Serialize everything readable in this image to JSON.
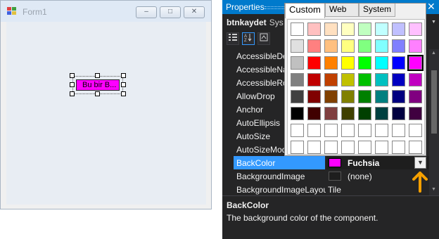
{
  "form": {
    "title": "Form1",
    "min_glyph": "–",
    "max_glyph": "□",
    "close_glyph": "✕",
    "button_text": "Bu bir B...",
    "button_color": "#ff00ff"
  },
  "properties": {
    "title": "Properties",
    "close_glyph": "✕",
    "dropdown_glyph": "▼",
    "object_name": "btnkaydet",
    "object_type": "Sys",
    "rows": [
      {
        "name": "AccessibleDe",
        "value": ""
      },
      {
        "name": "AccessibleNa",
        "value": ""
      },
      {
        "name": "AccessibleRo",
        "value": ""
      },
      {
        "name": "AllowDrop",
        "value": ""
      },
      {
        "name": "Anchor",
        "value": ""
      },
      {
        "name": "AutoEllipsis",
        "value": ""
      },
      {
        "name": "AutoSize",
        "value": ""
      },
      {
        "name": "AutoSizeMod",
        "value": ""
      },
      {
        "name": "BackColor",
        "value": "Fuchsia",
        "swatch": "#ff00ff",
        "selected": true
      },
      {
        "name": "BackgroundImage",
        "value": "(none)"
      },
      {
        "name": "BackgroundImageLayout",
        "value": "Tile"
      }
    ],
    "description": {
      "title": "BackColor",
      "text": "The background color of the component."
    },
    "accent_color": "#3399ff",
    "arrow_color": "#f5a000"
  },
  "color_picker": {
    "tabs": [
      "Custom",
      "Web",
      "System"
    ],
    "active_tab": "Custom",
    "selected_color": "#ff00ff",
    "grid": [
      [
        "#ffffff",
        "#ffc0c0",
        "#ffe0c0",
        "#ffffc0",
        "#c0ffc0",
        "#c0ffff",
        "#c0c0ff",
        "#ffc0ff"
      ],
      [
        "#e0e0e0",
        "#ff8080",
        "#ffc080",
        "#ffff80",
        "#80ff80",
        "#80ffff",
        "#8080ff",
        "#ff80ff"
      ],
      [
        "#c0c0c0",
        "#ff0000",
        "#ff8000",
        "#ffff00",
        "#00ff00",
        "#00ffff",
        "#0000ff",
        "#ff00ff"
      ],
      [
        "#808080",
        "#c00000",
        "#c04000",
        "#c0c000",
        "#00c000",
        "#00c0c0",
        "#0000c0",
        "#c000c0"
      ],
      [
        "#404040",
        "#800000",
        "#804000",
        "#808000",
        "#008000",
        "#008080",
        "#000080",
        "#800080"
      ],
      [
        "#000000",
        "#400000",
        "#804040",
        "#404000",
        "#004000",
        "#004040",
        "#000040",
        "#400040"
      ],
      [
        "#ffffff",
        "#ffffff",
        "#ffffff",
        "#ffffff",
        "#ffffff",
        "#ffffff",
        "#ffffff",
        "#ffffff"
      ],
      [
        "#ffffff",
        "#ffffff",
        "#ffffff",
        "#ffffff",
        "#ffffff",
        "#ffffff",
        "#ffffff",
        "#ffffff"
      ]
    ]
  }
}
